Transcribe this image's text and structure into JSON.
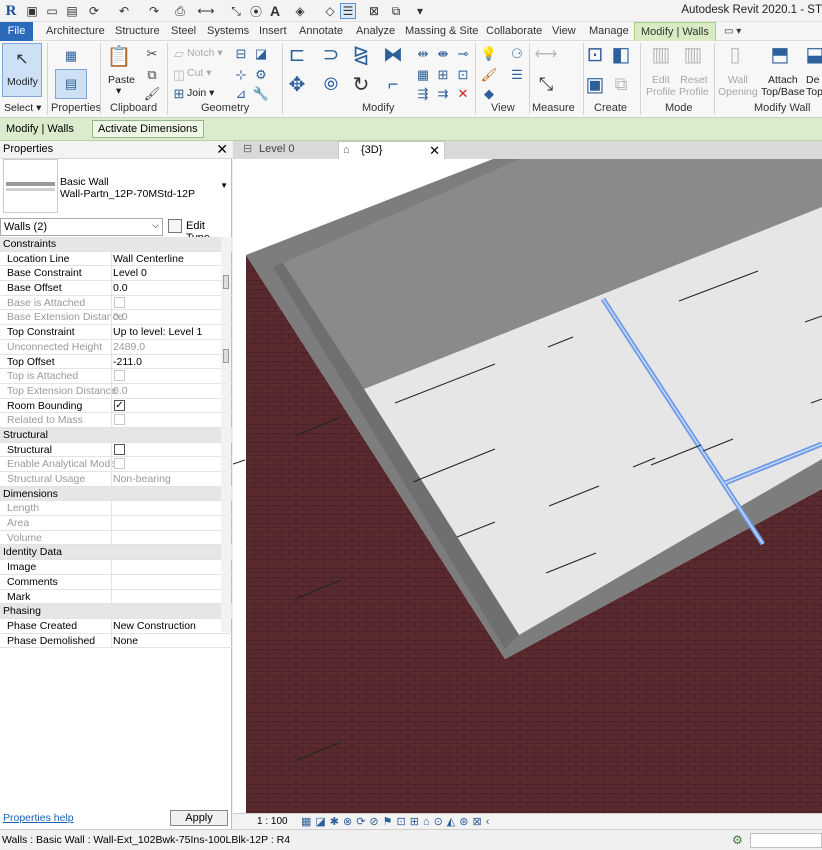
{
  "app": {
    "title": "Autodesk Revit 2020.1 - ST"
  },
  "quick_access": [
    "save-icon",
    "open-icon",
    "sync-icon",
    "undo-icon",
    "redo-icon",
    "print-icon",
    "measure-icon",
    "text-icon"
  ],
  "ribbon_tabs": [
    "File",
    "Architecture",
    "Structure",
    "Steel",
    "Systems",
    "Insert",
    "Annotate",
    "Analyze",
    "Massing & Site",
    "Collaborate",
    "View",
    "Manage",
    "Modify | Walls"
  ],
  "ribbon": {
    "modify_label": "Modify",
    "select_label": "Select",
    "properties_label": "Properties",
    "paste_label": "Paste",
    "clipboard_label": "Clipboard",
    "notch_label": "Notch",
    "cut_label": "Cut",
    "join_label": "Join",
    "geometry_label": "Geometry",
    "modify_panel_label": "Modify",
    "view_label": "View",
    "measure_label": "Measure",
    "create_label": "Create",
    "edit_profile_label": "Edit\nProfile",
    "reset_profile_label": "Reset\nProfile",
    "mode_label": "Mode",
    "wall_opening_label": "Wall\nOpening",
    "attach_top_base_label": "Attach\nTop/Base",
    "detach_label": "De\nTop/",
    "modify_wall_label": "Modify Wall"
  },
  "options_bar": {
    "context": "Modify | Walls",
    "button": "Activate Dimensions"
  },
  "properties": {
    "title": "Properties",
    "type_family": "Basic Wall",
    "type_name": "Wall-Partn_12P-70MStd-12P",
    "filter": "Walls (2)",
    "edit_type": "Edit Type",
    "help": "Properties help",
    "apply": "Apply",
    "rows": [
      {
        "kind": "section",
        "name": "Constraints"
      },
      {
        "kind": "prop",
        "name": "Location Line",
        "value": "Wall Centerline"
      },
      {
        "kind": "prop",
        "name": "Base Constraint",
        "value": "Level 0"
      },
      {
        "kind": "prop",
        "name": "Base Offset",
        "value": "0.0"
      },
      {
        "kind": "check",
        "name": "Base is Attached",
        "checked": false,
        "disabled": true
      },
      {
        "kind": "prop",
        "name": "Base Extension Distance",
        "value": "0.0",
        "disabled": true
      },
      {
        "kind": "prop",
        "name": "Top Constraint",
        "value": "Up to level: Level 1"
      },
      {
        "kind": "prop",
        "name": "Unconnected Height",
        "value": "2489.0",
        "disabled": true
      },
      {
        "kind": "prop",
        "name": "Top Offset",
        "value": "-211.0"
      },
      {
        "kind": "check",
        "name": "Top is Attached",
        "checked": false,
        "disabled": true
      },
      {
        "kind": "prop",
        "name": "Top Extension Distance",
        "value": "0.0",
        "disabled": true
      },
      {
        "kind": "check",
        "name": "Room Bounding",
        "checked": true,
        "disabled": false
      },
      {
        "kind": "check",
        "name": "Related to Mass",
        "checked": false,
        "disabled": true
      },
      {
        "kind": "section",
        "name": "Structural"
      },
      {
        "kind": "check",
        "name": "Structural",
        "checked": false,
        "disabled": false
      },
      {
        "kind": "check",
        "name": "Enable Analytical Model",
        "checked": false,
        "disabled": true
      },
      {
        "kind": "prop",
        "name": "Structural Usage",
        "value": "Non-bearing",
        "disabled": true
      },
      {
        "kind": "section",
        "name": "Dimensions"
      },
      {
        "kind": "prop",
        "name": "Length",
        "value": "",
        "disabled": true
      },
      {
        "kind": "prop",
        "name": "Area",
        "value": "",
        "disabled": true
      },
      {
        "kind": "prop",
        "name": "Volume",
        "value": "",
        "disabled": true
      },
      {
        "kind": "section",
        "name": "Identity Data"
      },
      {
        "kind": "prop",
        "name": "Image",
        "value": ""
      },
      {
        "kind": "prop",
        "name": "Comments",
        "value": ""
      },
      {
        "kind": "prop",
        "name": "Mark",
        "value": ""
      },
      {
        "kind": "section",
        "name": "Phasing"
      },
      {
        "kind": "prop",
        "name": "Phase Created",
        "value": "New Construction"
      },
      {
        "kind": "prop",
        "name": "Phase Demolished",
        "value": "None"
      }
    ]
  },
  "view_tabs": {
    "level0": "Level 0",
    "active": "{3D}"
  },
  "view_control": {
    "scale": "1 : 100"
  },
  "status": {
    "text": "Walls : Basic Wall : Wall-Ext_102Bwk-75Ins-100LBlk-12P : R4"
  },
  "colors": {
    "accent": "#2a6ab8",
    "context_tab": "#d8ecc4",
    "brick": "#5a2a2e",
    "selected_edge": "#6f9be6"
  }
}
